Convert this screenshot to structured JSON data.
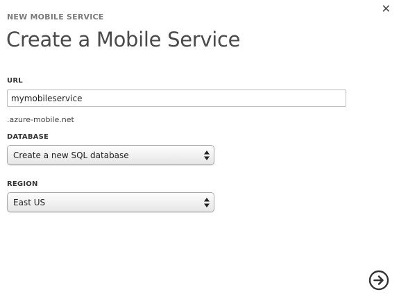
{
  "header": {
    "eyebrow": "NEW MOBILE SERVICE",
    "title": "Create a Mobile Service"
  },
  "form": {
    "url": {
      "label": "URL",
      "value": "mymobileservice",
      "suffix": ".azure-mobile.net"
    },
    "database": {
      "label": "DATABASE",
      "selected": "Create a new SQL database"
    },
    "region": {
      "label": "REGION",
      "selected": "East US"
    }
  },
  "icons": {
    "close": "close-icon",
    "next": "arrow-right-circle-icon",
    "select_arrows": "updown-arrows-icon"
  }
}
